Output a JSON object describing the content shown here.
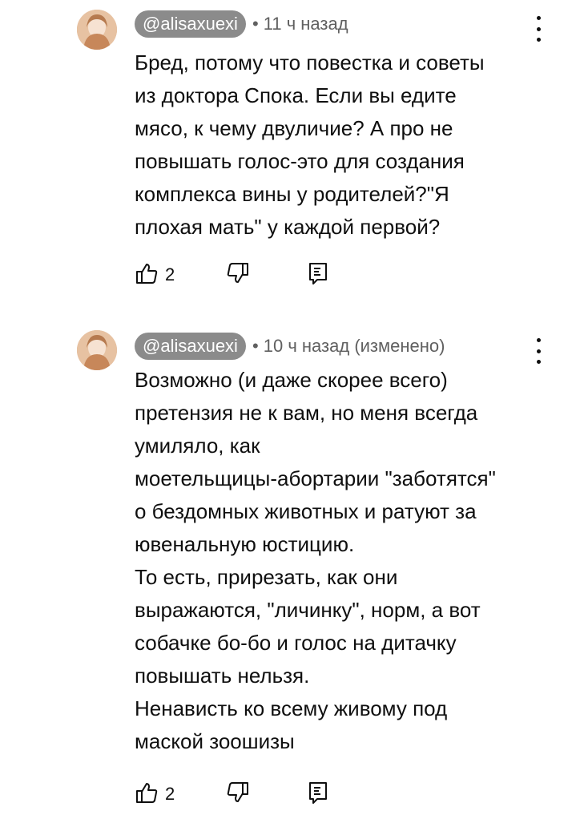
{
  "comments": [
    {
      "handle": "@alisaxuexi",
      "time": "• 11 ч назад",
      "lines": [
        "Бред, потому что повестка и советы",
        "из доктора Спока. Если вы едите",
        "мясо, к чему двуличие? А про не",
        "повышать голос-это для создания",
        "комплекса вины у родителей?\"Я",
        "плохая мать\" у каждой первой?"
      ],
      "likes": "2"
    },
    {
      "handle": "@alisaxuexi",
      "time": "• 10 ч назад (изменено)",
      "lines": [
        "Возможно (и даже скорее всего)",
        "претензия не к вам, но меня всегда",
        "умиляло, как",
        "моетельщицы-абортарии \"заботятся\"",
        "о бездомных животных и ратуют за",
        "ювенальную юстицию.",
        "То есть, прирезать, как они",
        "выражаются, \"личинку\", норм, а вот",
        "собачке бо-бо и голос на дитачку",
        "повышать нельзя.",
        "Ненависть ко всему живому под",
        "маской зоошизы"
      ],
      "likes": "2"
    }
  ],
  "icons": {
    "like": "thumb-up-icon",
    "dislike": "thumb-down-icon",
    "reply": "reply-icon",
    "more": "more-vertical-icon"
  }
}
